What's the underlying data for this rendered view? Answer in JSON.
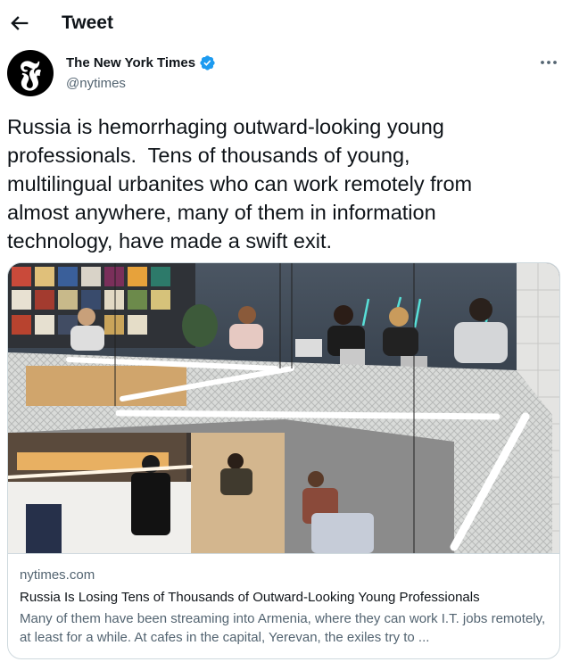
{
  "header": {
    "title": "Tweet",
    "back_icon": "arrow-left-icon"
  },
  "author": {
    "name": "The New York Times",
    "handle": "@nytimes",
    "avatar_letter": "𝕱",
    "verified": true,
    "verified_color": "#1d9bf0"
  },
  "tweet": {
    "text": "Russia is hemorrhaging outward-looking young\nprofessionals.  Tens of thousands of young,\nmultilingual urbanites who can work remotely from\nalmost anywhere, many of them in information\ntechnology, have made a swift exit."
  },
  "card": {
    "domain": "nytimes.com",
    "title": "Russia Is Losing Tens of Thousands of Outward-Looking Young Professionals",
    "description": "Many of them have been streaming into Armenia, where they can work I.T. jobs remotely, at least for a while. At cafes in the capital, Yerevan, the exiles try to ...",
    "image_alt": "cafe interior with people working on laptops on a mezzanine"
  },
  "colors": {
    "text": "#0f1419",
    "secondary": "#536471",
    "border": "#cfd9de"
  }
}
